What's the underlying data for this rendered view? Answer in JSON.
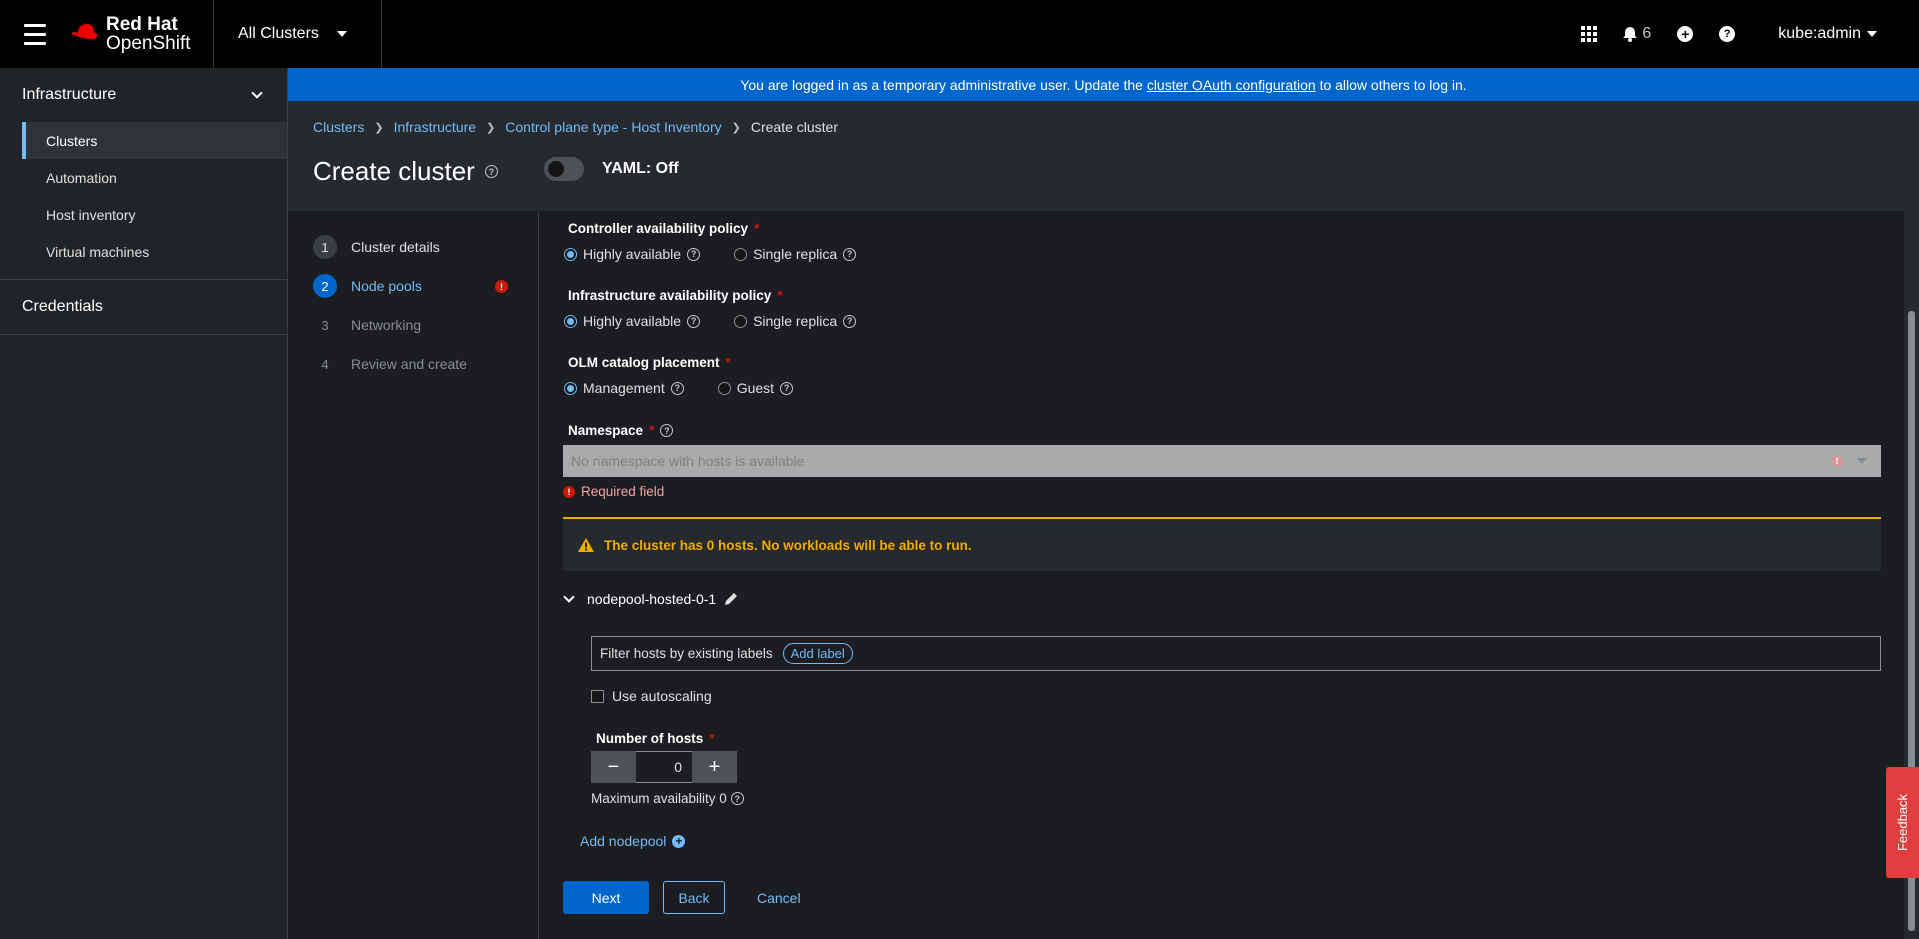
{
  "masthead": {
    "brand_line1": "Red Hat",
    "brand_line2": "OpenShift",
    "cluster_switcher": "All Clusters",
    "notification_count": "6",
    "user": "kube:admin"
  },
  "sidebar": {
    "groups": [
      {
        "label": "Infrastructure",
        "items": [
          "Clusters",
          "Automation",
          "Host inventory",
          "Virtual machines"
        ]
      },
      {
        "label": "Credentials"
      }
    ],
    "active_item": "Clusters"
  },
  "banner": {
    "text_before": "You are logged in as a temporary administrative user. Update the",
    "link": "cluster OAuth configuration",
    "text_after": "to allow others to log in."
  },
  "breadcrumb": [
    "Clusters",
    "Infrastructure",
    "Control plane type - Host Inventory",
    "Create cluster"
  ],
  "page": {
    "title": "Create cluster",
    "yaml_toggle": "YAML: Off"
  },
  "wizard": {
    "steps": [
      {
        "num": "1",
        "label": "Cluster details",
        "state": "done"
      },
      {
        "num": "2",
        "label": "Node pools",
        "state": "current"
      },
      {
        "num": "3",
        "label": "Networking",
        "state": "pending"
      },
      {
        "num": "4",
        "label": "Review and create",
        "state": "pending"
      }
    ]
  },
  "form": {
    "controller_policy": {
      "label": "Controller availability policy",
      "options": [
        "Highly available",
        "Single replica"
      ],
      "selected": "Highly available"
    },
    "infra_policy": {
      "label": "Infrastructure availability policy",
      "options": [
        "Highly available",
        "Single replica"
      ],
      "selected": "Highly available"
    },
    "olm_placement": {
      "label": "OLM catalog placement",
      "options": [
        "Management",
        "Guest"
      ],
      "selected": "Management"
    },
    "namespace": {
      "label": "Namespace",
      "placeholder": "No namespace with hosts is available",
      "error": "Required field"
    },
    "warning": "The cluster has 0 hosts. No workloads will be able to run.",
    "nodepool": {
      "name": "nodepool-hosted-0-1",
      "filter_label": "Filter hosts by existing labels",
      "add_label": "Add label",
      "autoscaling_label": "Use autoscaling",
      "hosts_label": "Number of hosts",
      "hosts_value": "0",
      "max_availability": "Maximum availability 0"
    },
    "add_nodepool": "Add nodepool",
    "buttons": {
      "next": "Next",
      "back": "Back",
      "cancel": "Cancel"
    }
  },
  "feedback": "Feedback",
  "colors": {
    "accent": "#0066cc",
    "link": "#73bcf7",
    "warning": "#f0ab00",
    "danger": "#c9190b",
    "feedback": "#e03e3e"
  }
}
